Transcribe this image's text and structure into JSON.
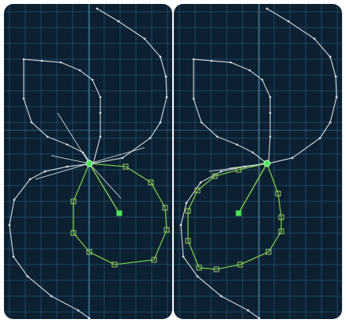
{
  "colors": {
    "background": "#0c2031",
    "grid": "#28516a",
    "grid_major": "#3d7392",
    "wire": "#d6dee4",
    "selected_wire": "#7fcf4c",
    "handle": "#9fcd63",
    "active_handle": "#4ee35a"
  },
  "panels": [
    {
      "id": "left",
      "shape_nodes": [
        [
          118,
          6
        ],
        [
          145,
          22
        ],
        [
          178,
          44
        ],
        [
          198,
          67
        ],
        [
          205,
          92
        ],
        [
          206,
          118
        ],
        [
          198,
          150
        ],
        [
          185,
          170
        ],
        [
          150,
          195
        ],
        [
          112,
          202
        ],
        [
          80,
          206
        ],
        [
          52,
          212
        ],
        [
          33,
          222
        ],
        [
          13,
          248
        ],
        [
          7,
          280
        ],
        [
          12,
          320
        ],
        [
          30,
          345
        ],
        [
          60,
          370
        ],
        [
          94,
          388
        ],
        [
          108,
          398
        ]
      ],
      "upper_loop": [
        [
          110,
          202
        ],
        [
          100,
          188
        ],
        [
          80,
          178
        ],
        [
          55,
          168
        ],
        [
          35,
          150
        ],
        [
          25,
          120
        ],
        [
          25,
          70
        ],
        [
          48,
          72
        ],
        [
          72,
          74
        ],
        [
          96,
          84
        ],
        [
          112,
          96
        ],
        [
          122,
          118
        ],
        [
          122,
          138
        ],
        [
          122,
          168
        ],
        [
          113,
          202
        ]
      ],
      "rays_to": [
        [
          68,
          138
        ],
        [
          60,
          192
        ],
        [
          40,
          222
        ],
        [
          148,
          246
        ],
        [
          178,
          182
        ]
      ],
      "selected_loop": [
        [
          108,
          202
        ],
        [
          154,
          206
        ],
        [
          186,
          226
        ],
        [
          204,
          258
        ],
        [
          206,
          286
        ],
        [
          190,
          324
        ],
        [
          140,
          330
        ],
        [
          108,
          314
        ],
        [
          88,
          290
        ],
        [
          88,
          250
        ]
      ],
      "focus_from": [
        108,
        202
      ],
      "focus_to": [
        146,
        265
      ]
    },
    {
      "id": "right",
      "shape_nodes": [
        [
          118,
          6
        ],
        [
          145,
          22
        ],
        [
          178,
          44
        ],
        [
          198,
          67
        ],
        [
          205,
          92
        ],
        [
          206,
          118
        ],
        [
          198,
          150
        ],
        [
          185,
          170
        ],
        [
          150,
          195
        ],
        [
          120,
          202
        ],
        [
          90,
          206
        ],
        [
          60,
          212
        ],
        [
          34,
          226
        ],
        [
          16,
          252
        ],
        [
          9,
          280
        ],
        [
          12,
          320
        ],
        [
          30,
          345
        ],
        [
          60,
          370
        ],
        [
          94,
          388
        ],
        [
          108,
          398
        ]
      ],
      "upper_loop": [
        [
          118,
          202
        ],
        [
          100,
          188
        ],
        [
          80,
          178
        ],
        [
          55,
          168
        ],
        [
          35,
          150
        ],
        [
          25,
          120
        ],
        [
          25,
          70
        ],
        [
          48,
          72
        ],
        [
          72,
          74
        ],
        [
          96,
          84
        ],
        [
          112,
          96
        ],
        [
          122,
          118
        ],
        [
          122,
          138
        ],
        [
          122,
          168
        ],
        [
          120,
          202
        ]
      ],
      "rays_to": [
        [
          70,
          208
        ],
        [
          45,
          212
        ],
        [
          110,
          202
        ]
      ],
      "selected_loop": [
        [
          118,
          202
        ],
        [
          132,
          240
        ],
        [
          136,
          270
        ],
        [
          136,
          288
        ],
        [
          120,
          314
        ],
        [
          84,
          330
        ],
        [
          54,
          336
        ],
        [
          32,
          334
        ],
        [
          18,
          300
        ],
        [
          18,
          262
        ],
        [
          30,
          236
        ],
        [
          52,
          218
        ],
        [
          82,
          210
        ]
      ],
      "focus_from": [
        118,
        202
      ],
      "focus_to": [
        82,
        265
      ]
    }
  ]
}
